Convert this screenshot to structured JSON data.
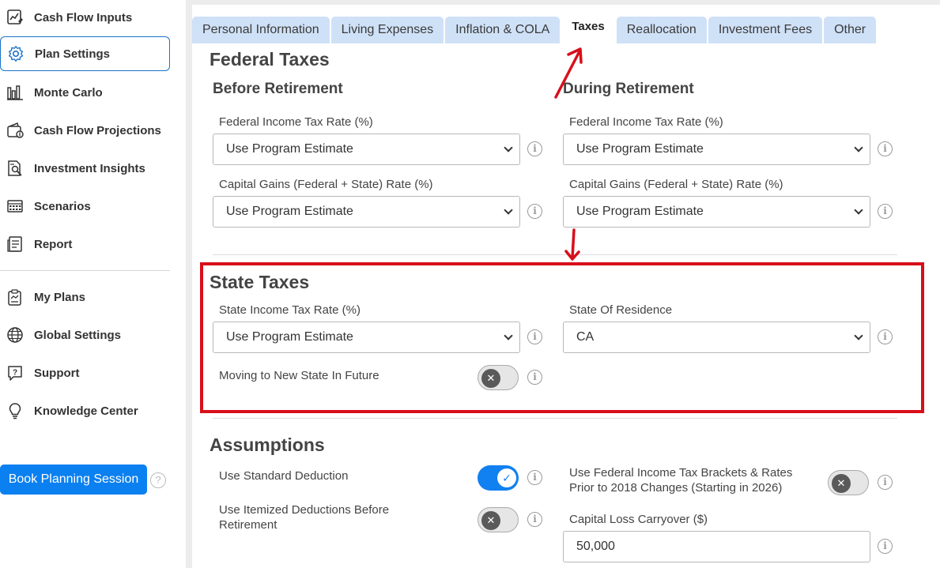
{
  "sidebar": {
    "items": [
      {
        "label": "Cash Flow Inputs",
        "icon": "chart-edit-icon"
      },
      {
        "label": "Plan Settings",
        "icon": "gear-icon"
      },
      {
        "label": "Monte Carlo",
        "icon": "bar-chart-icon"
      },
      {
        "label": "Cash Flow Projections",
        "icon": "wallet-icon"
      },
      {
        "label": "Investment Insights",
        "icon": "document-search-icon"
      },
      {
        "label": "Scenarios",
        "icon": "calculator-icon"
      },
      {
        "label": "Report",
        "icon": "report-icon"
      },
      {
        "label": "My Plans",
        "icon": "clipboard-icon"
      },
      {
        "label": "Global Settings",
        "icon": "globe-icon"
      },
      {
        "label": "Support",
        "icon": "chat-question-icon"
      },
      {
        "label": "Knowledge Center",
        "icon": "lightbulb-icon"
      }
    ],
    "book_button": "Book Planning Session",
    "help": "?"
  },
  "tabs": [
    "Personal Information",
    "Living Expenses",
    "Inflation & COLA",
    "Taxes",
    "Reallocation",
    "Investment Fees",
    "Other"
  ],
  "federal": {
    "title": "Federal Taxes",
    "before": {
      "heading": "Before Retirement",
      "income_label": "Federal Income Tax Rate (%)",
      "income_value": "Use Program Estimate",
      "capgains_label": "Capital Gains (Federal + State) Rate (%)",
      "capgains_value": "Use Program Estimate"
    },
    "during": {
      "heading": "During Retirement",
      "income_label": "Federal Income Tax Rate (%)",
      "income_value": "Use Program Estimate",
      "capgains_label": "Capital Gains (Federal + State) Rate (%)",
      "capgains_value": "Use Program Estimate"
    }
  },
  "state": {
    "title": "State Taxes",
    "income_label": "State Income Tax Rate (%)",
    "income_value": "Use Program Estimate",
    "residence_label": "State Of Residence",
    "residence_value": "CA",
    "moving_label": "Moving to New State In Future",
    "moving_on": false
  },
  "assumptions": {
    "title": "Assumptions",
    "standard_label": "Use Standard Deduction",
    "standard_on": true,
    "itemized_label_1": "Use Itemized Deductions Before",
    "itemized_label_2": "Retirement",
    "itemized_on": false,
    "brackets_label_1": "Use Federal Income Tax Brackets & Rates",
    "brackets_label_2": "Prior to 2018 Changes (Starting in 2026)",
    "brackets_on": false,
    "carryover_label": "Capital Loss Carryover ($)",
    "carryover_value": "50,000"
  },
  "info_glyph": "i",
  "check_glyph": "✓",
  "x_glyph": "✕",
  "colors": {
    "accent": "#0b80f0",
    "highlight": "#d70f1b",
    "tab": "#cfe1f7"
  }
}
